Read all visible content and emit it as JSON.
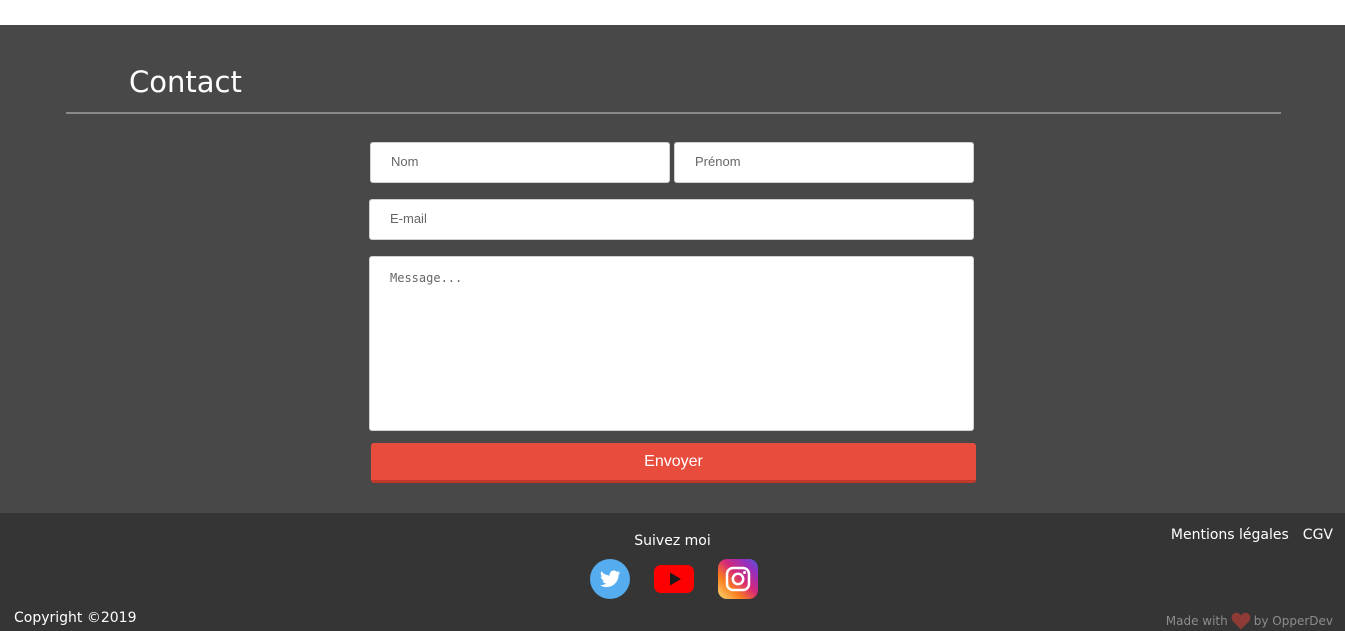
{
  "contact": {
    "title": "Contact",
    "form": {
      "nom_placeholder": "Nom",
      "prenom_placeholder": "Prénom",
      "email_placeholder": "E-mail",
      "message_placeholder": "Message...",
      "submit_label": "Envoyer"
    }
  },
  "footer": {
    "follow_label": "Suivez moi",
    "social_icons": [
      "twitter-icon",
      "youtube-icon",
      "instagram-icon"
    ],
    "legal_links": [
      "Mentions légales",
      "CGV"
    ],
    "copyright": "Copyright ©2019",
    "made_with_prefix": "Made with",
    "made_with_suffix": "by OpperDev"
  },
  "colors": {
    "section_bg": "#484848",
    "footer_bg": "#353535",
    "accent": "#e74c3c"
  }
}
